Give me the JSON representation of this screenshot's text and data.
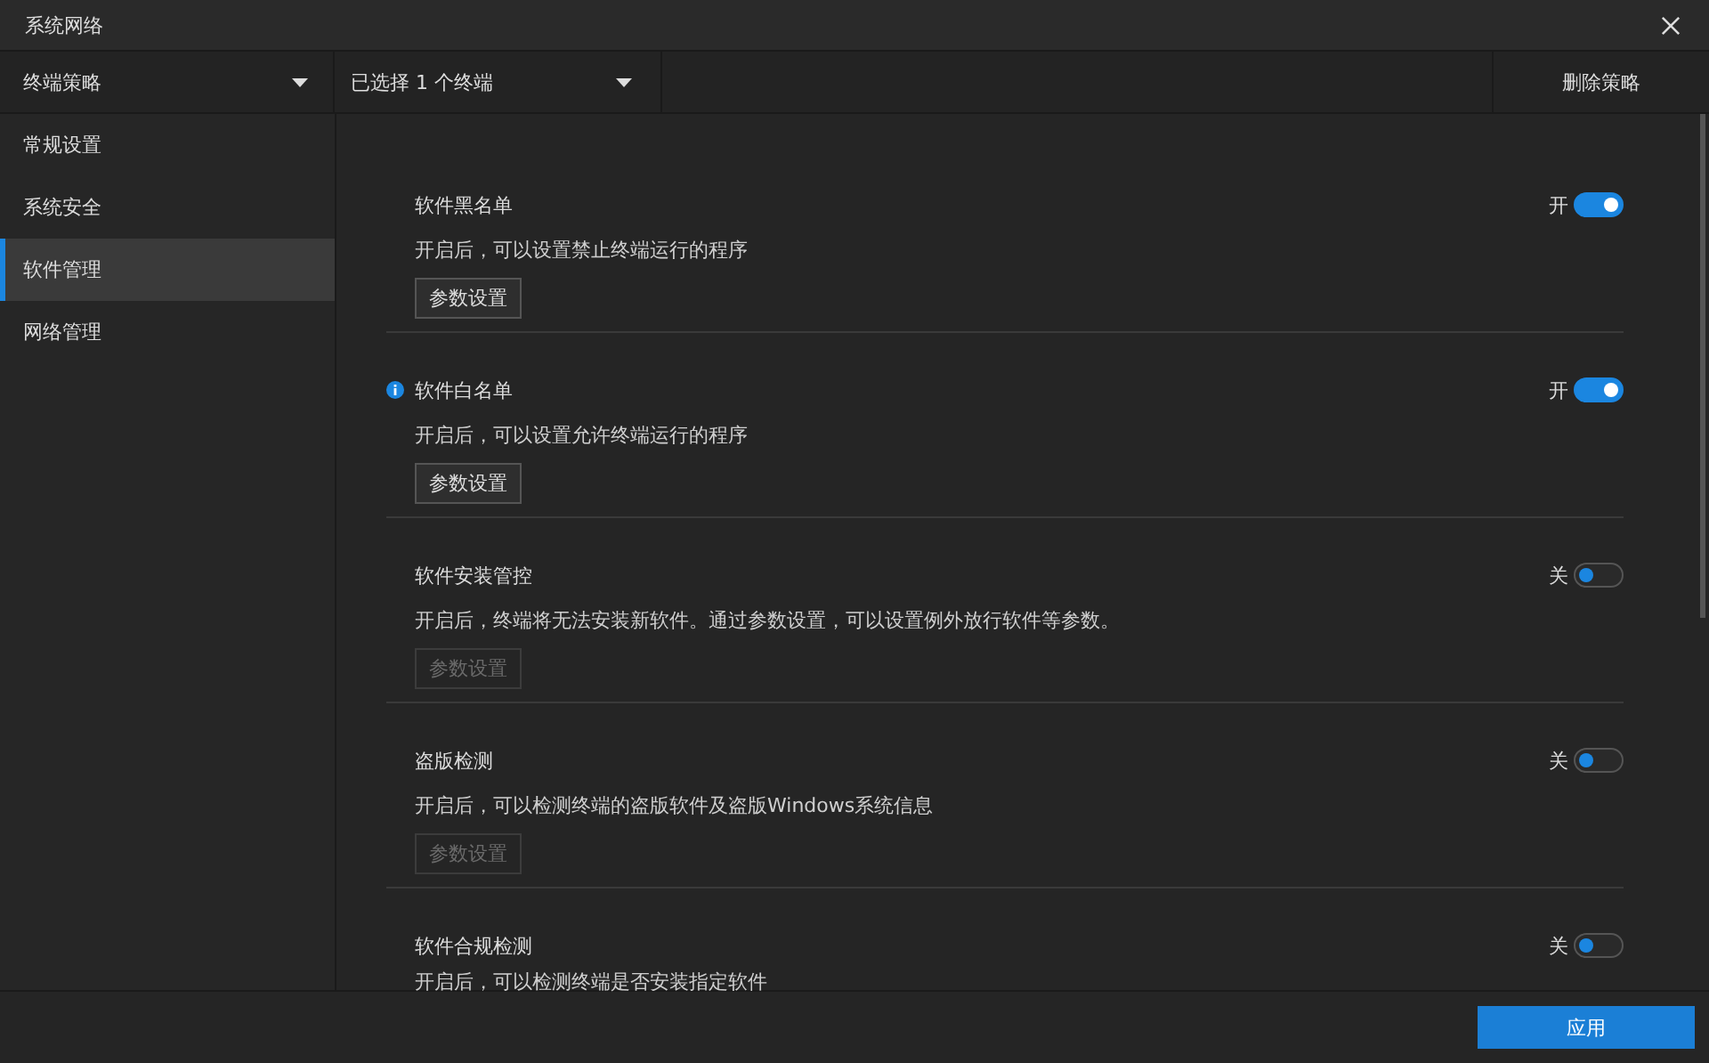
{
  "window": {
    "title": "系统网络"
  },
  "toolbar": {
    "policy_dropdown": "终端策略",
    "terminal_dropdown": "已选择 1 个终端",
    "delete_button": "删除策略"
  },
  "sidebar": {
    "items": [
      {
        "label": "常规设置",
        "selected": false
      },
      {
        "label": "系统安全",
        "selected": false
      },
      {
        "label": "软件管理",
        "selected": true
      },
      {
        "label": "网络管理",
        "selected": false
      }
    ]
  },
  "sections": [
    {
      "title": "软件黑名单",
      "info": false,
      "description": "开启后，可以设置禁止终端运行的程序",
      "toggle_label": "开",
      "on": true,
      "button": "参数设置",
      "disabled": false
    },
    {
      "title": "软件白名单",
      "info": true,
      "description": "开启后，可以设置允许终端运行的程序",
      "toggle_label": "开",
      "on": true,
      "button": "参数设置",
      "disabled": false
    },
    {
      "title": "软件安装管控",
      "info": false,
      "description": "开启后，终端将无法安装新软件。通过参数设置，可以设置例外放行软件等参数。",
      "toggle_label": "关",
      "on": false,
      "button": "参数设置",
      "disabled": true
    },
    {
      "title": "盗版检测",
      "info": false,
      "description": "开启后，可以检测终端的盗版软件及盗版Windows系统信息",
      "toggle_label": "关",
      "on": false,
      "button": "参数设置",
      "disabled": true
    },
    {
      "title": "软件合规检测",
      "info": false,
      "description": "开启后，可以检测终端是否安装指定软件",
      "toggle_label": "关",
      "on": false
    }
  ],
  "footer": {
    "apply_button": "应用"
  }
}
